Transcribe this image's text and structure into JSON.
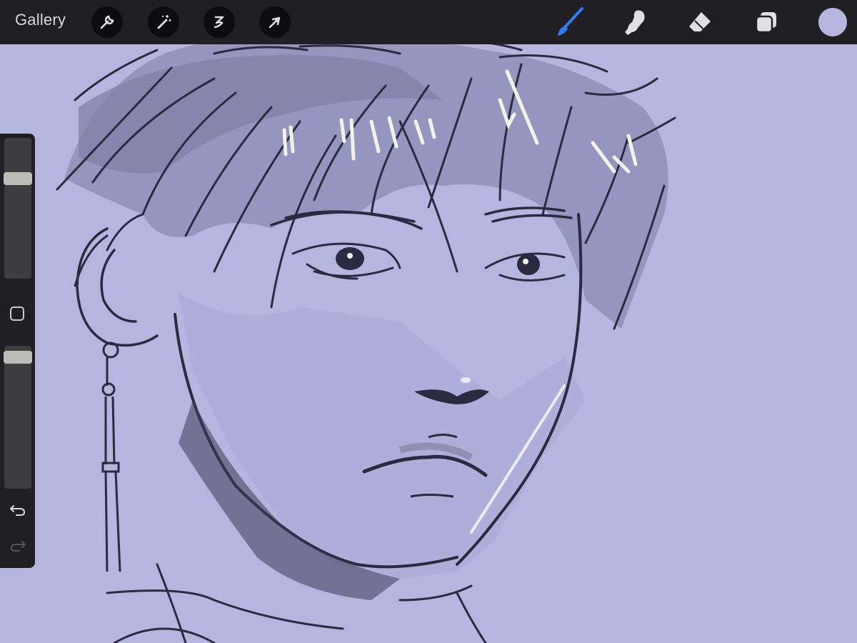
{
  "app": {
    "gallery_label": "Gallery",
    "left_tools": [
      {
        "name": "actions",
        "icon": "wrench-icon"
      },
      {
        "name": "adjustments",
        "icon": "magic-wand-icon"
      },
      {
        "name": "selection",
        "icon": "selection-s-icon"
      },
      {
        "name": "transform",
        "icon": "arrow-cursor-icon"
      }
    ],
    "right_tools": [
      {
        "name": "brush",
        "icon": "brush-icon",
        "active": true
      },
      {
        "name": "smudge",
        "icon": "smudge-finger-icon",
        "active": false
      },
      {
        "name": "eraser",
        "icon": "eraser-icon",
        "active": false
      },
      {
        "name": "layers",
        "icon": "layers-icon",
        "active": false
      }
    ],
    "color_swatch": "#b4b6e0"
  },
  "sidebar": {
    "brush_size_level": 0.73,
    "opacity_level": 0.96,
    "modifier_button_icon": "square-icon",
    "undo_icon": "undo-arrow-icon",
    "redo_icon": "redo-arrow-icon"
  },
  "colors": {
    "canvas_background": "#b4b6e0",
    "toolbar_background": "#202024",
    "active_tool": "#2f7cf6",
    "line_art": "#2a2b40"
  }
}
